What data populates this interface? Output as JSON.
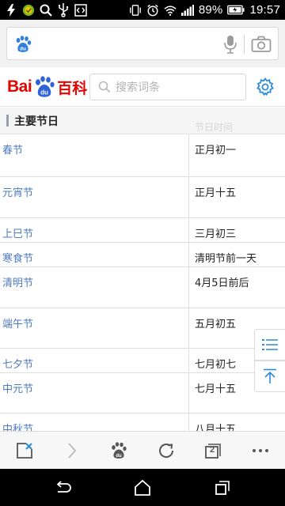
{
  "status_bar": {
    "battery_percent": "89%",
    "time": "19:57",
    "icons": [
      "flash-icon",
      "coin-icon",
      "search-icon",
      "usb-icon",
      "code-icon",
      "vibrate-icon",
      "alarm-icon",
      "wifi-icon",
      "signal-icon",
      "battery-icon"
    ]
  },
  "browser": {
    "address_value": "",
    "icons": [
      "baidu-paw-icon",
      "microphone-icon",
      "camera-icon"
    ]
  },
  "baike": {
    "logo_left": "Bai",
    "logo_right": "百科",
    "search_placeholder": "搜索词条"
  },
  "section": {
    "title": "主要节日",
    "ghost_header": "节日时间"
  },
  "table": {
    "rows": [
      {
        "name": "春节",
        "date": "正月初一"
      },
      {
        "name": "元宵节",
        "date": "正月十五"
      },
      {
        "name": "上巳节",
        "date": "三月初三"
      },
      {
        "name": "寒食节",
        "date": "清明节前一天"
      },
      {
        "name": "清明节",
        "date": "4月5日前后"
      },
      {
        "name": "端午节",
        "date": "五月初五"
      },
      {
        "name": "七夕节",
        "date": "七月初七"
      },
      {
        "name": "中元节",
        "date": "七月十五"
      },
      {
        "name": "中秋节",
        "date": "八月十五"
      }
    ]
  },
  "toolbar": {
    "tab_count": "2",
    "icons": [
      "close-tab-icon",
      "forward-icon",
      "baidu-home-icon",
      "refresh-icon",
      "tabs-icon",
      "more-icon"
    ]
  },
  "colors": {
    "accent_blue": "#2d8cd8",
    "baidu_red": "#e10602",
    "link_blue": "#4e7bbd"
  }
}
